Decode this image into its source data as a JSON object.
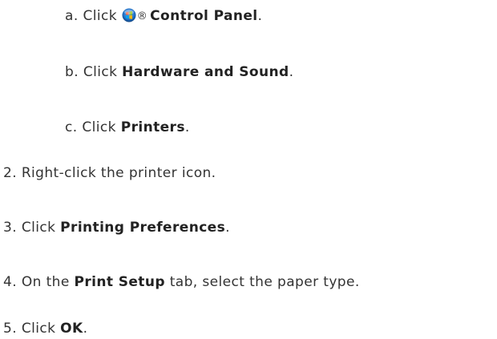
{
  "steps": {
    "a": {
      "marker": "a.",
      "prefix": "Click",
      "icon": "windows-start-orb-icon",
      "symbol": "®",
      "bold": "Control Panel",
      "suffix": "."
    },
    "b": {
      "marker": "b.",
      "prefix": "Click",
      "bold": "Hardware and Sound",
      "suffix": "."
    },
    "c": {
      "marker": "c.",
      "prefix": "Click",
      "bold": "Printers",
      "suffix": "."
    },
    "s2": {
      "marker": "2.",
      "text": "Right-click the printer icon."
    },
    "s3": {
      "marker": "3.",
      "prefix": "Click",
      "bold": "Printing Preferences",
      "suffix": "."
    },
    "s4": {
      "marker": "4.",
      "prefix": "On the",
      "bold": "Print Setup",
      "suffix": "tab, select the paper type."
    },
    "s5": {
      "marker": "5.",
      "prefix": "Click",
      "bold": "OK",
      "suffix": "."
    }
  },
  "colors": {
    "text": "#333333",
    "bold_text": "#222222",
    "icon_blue": "#1f6fc5"
  }
}
